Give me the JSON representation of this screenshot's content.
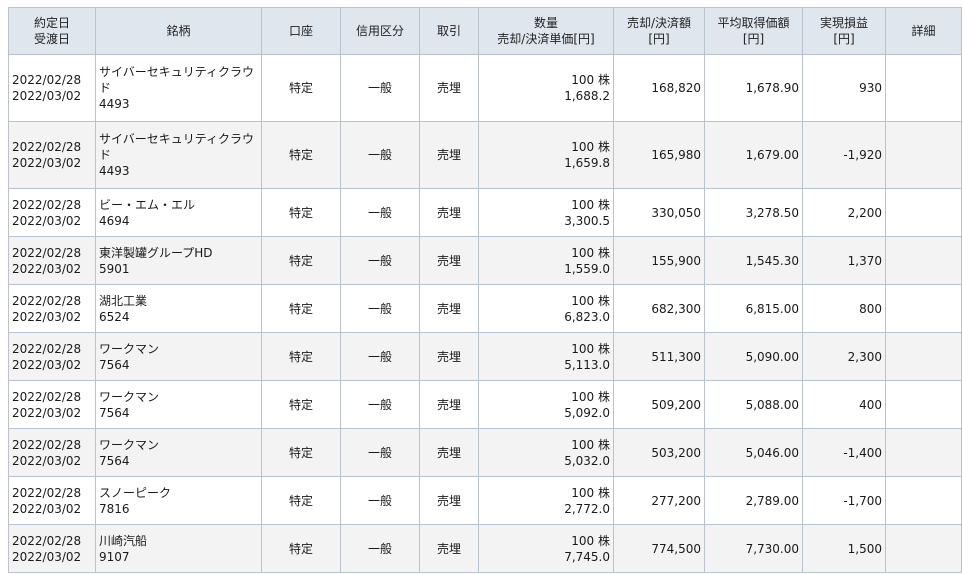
{
  "headers": {
    "date_trade": "約定日",
    "date_settle": "受渡日",
    "name": "銘柄",
    "account": "口座",
    "credit": "信用区分",
    "trade": "取引",
    "qty": "数量",
    "unit_price": "売却/決済単価[円]",
    "amount_1": "売却/決済額",
    "amount_2": "[円]",
    "avg_1": "平均取得価額",
    "avg_2": "[円]",
    "pnl_1": "実現損益",
    "pnl_2": "[円]",
    "detail": "詳細"
  },
  "rows": [
    {
      "trade_date": "2022/02/28",
      "settle_date": "2022/03/02",
      "name": "サイバーセキュリティクラウド",
      "code": "4493",
      "account": "特定",
      "credit": "一般",
      "type": "売埋",
      "qty": "100 株",
      "price": "1,688.2",
      "amount": "168,820",
      "avg": "1,678.90",
      "pnl": "930"
    },
    {
      "trade_date": "2022/02/28",
      "settle_date": "2022/03/02",
      "name": "サイバーセキュリティクラウド",
      "code": "4493",
      "account": "特定",
      "credit": "一般",
      "type": "売埋",
      "qty": "100 株",
      "price": "1,659.8",
      "amount": "165,980",
      "avg": "1,679.00",
      "pnl": "-1,920"
    },
    {
      "trade_date": "2022/02/28",
      "settle_date": "2022/03/02",
      "name": "ビー・エム・エル",
      "code": "4694",
      "account": "特定",
      "credit": "一般",
      "type": "売埋",
      "qty": "100 株",
      "price": "3,300.5",
      "amount": "330,050",
      "avg": "3,278.50",
      "pnl": "2,200"
    },
    {
      "trade_date": "2022/02/28",
      "settle_date": "2022/03/02",
      "name": "東洋製罐グループHD",
      "code": "5901",
      "account": "特定",
      "credit": "一般",
      "type": "売埋",
      "qty": "100 株",
      "price": "1,559.0",
      "amount": "155,900",
      "avg": "1,545.30",
      "pnl": "1,370"
    },
    {
      "trade_date": "2022/02/28",
      "settle_date": "2022/03/02",
      "name": "湖北工業",
      "code": "6524",
      "account": "特定",
      "credit": "一般",
      "type": "売埋",
      "qty": "100 株",
      "price": "6,823.0",
      "amount": "682,300",
      "avg": "6,815.00",
      "pnl": "800"
    },
    {
      "trade_date": "2022/02/28",
      "settle_date": "2022/03/02",
      "name": "ワークマン",
      "code": "7564",
      "account": "特定",
      "credit": "一般",
      "type": "売埋",
      "qty": "100 株",
      "price": "5,113.0",
      "amount": "511,300",
      "avg": "5,090.00",
      "pnl": "2,300"
    },
    {
      "trade_date": "2022/02/28",
      "settle_date": "2022/03/02",
      "name": "ワークマン",
      "code": "7564",
      "account": "特定",
      "credit": "一般",
      "type": "売埋",
      "qty": "100 株",
      "price": "5,092.0",
      "amount": "509,200",
      "avg": "5,088.00",
      "pnl": "400"
    },
    {
      "trade_date": "2022/02/28",
      "settle_date": "2022/03/02",
      "name": "ワークマン",
      "code": "7564",
      "account": "特定",
      "credit": "一般",
      "type": "売埋",
      "qty": "100 株",
      "price": "5,032.0",
      "amount": "503,200",
      "avg": "5,046.00",
      "pnl": "-1,400"
    },
    {
      "trade_date": "2022/02/28",
      "settle_date": "2022/03/02",
      "name": "スノーピーク",
      "code": "7816",
      "account": "特定",
      "credit": "一般",
      "type": "売埋",
      "qty": "100 株",
      "price": "2,772.0",
      "amount": "277,200",
      "avg": "2,789.00",
      "pnl": "-1,700"
    },
    {
      "trade_date": "2022/02/28",
      "settle_date": "2022/03/02",
      "name": "川崎汽船",
      "code": "9107",
      "account": "特定",
      "credit": "一般",
      "type": "売埋",
      "qty": "100 株",
      "price": "7,745.0",
      "amount": "774,500",
      "avg": "7,730.00",
      "pnl": "1,500"
    }
  ]
}
